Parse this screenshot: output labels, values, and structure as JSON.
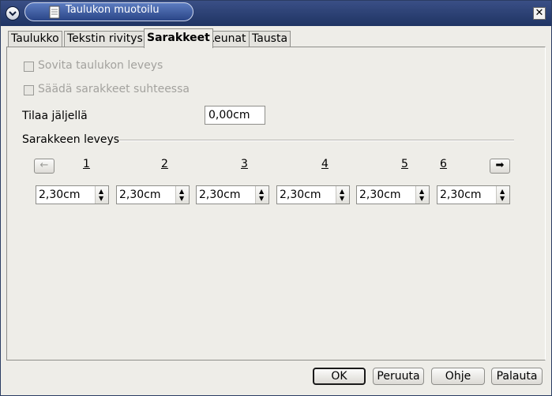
{
  "window": {
    "title": "Taulukon muotoilu",
    "close_glyph": "✕"
  },
  "tabs": [
    {
      "label": "Taulukko"
    },
    {
      "label": "Tekstin rivitys"
    },
    {
      "label": "Sarakkeet",
      "active": true
    },
    {
      "label": "Reunat"
    },
    {
      "label": "Tausta"
    }
  ],
  "options": {
    "fit_width": {
      "label": "Sovita taulukon leveys",
      "checked": false,
      "enabled": false
    },
    "adjust_relative": {
      "label": "Säädä sarakkeet suhteessa",
      "checked": false,
      "enabled": false
    }
  },
  "remaining": {
    "label": "Tilaa jäljellä",
    "value": "0,00cm"
  },
  "column_widths": {
    "group_label": "Sarakkeen leveys",
    "prev_glyph": "←",
    "next_glyph": "➡",
    "columns": [
      {
        "number": "1",
        "value": "2,30cm"
      },
      {
        "number": "2",
        "value": "2,30cm"
      },
      {
        "number": "3",
        "value": "2,30cm"
      },
      {
        "number": "4",
        "value": "2,30cm"
      },
      {
        "number": "5",
        "value": "2,30cm"
      },
      {
        "number": "6",
        "value": "2,30cm"
      }
    ]
  },
  "buttons": {
    "ok": "OK",
    "cancel": "Peruuta",
    "help": "Ohje",
    "reset": "Palauta"
  }
}
